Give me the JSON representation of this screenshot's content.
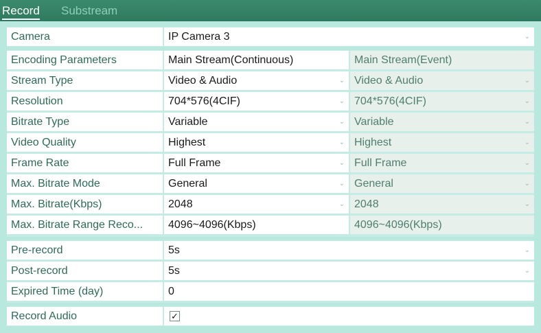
{
  "tabs": {
    "record": "Record",
    "substream": "Substream"
  },
  "camera": {
    "label": "Camera",
    "value": "IP Camera 3"
  },
  "encoding": {
    "label": "Encoding Parameters",
    "col1": "Main Stream(Continuous)",
    "col2": "Main Stream(Event)"
  },
  "params": [
    {
      "label": "Stream Type",
      "v1": "Video & Audio",
      "v2": "Video & Audio"
    },
    {
      "label": "Resolution",
      "v1": "704*576(4CIF)",
      "v2": "704*576(4CIF)"
    },
    {
      "label": "Bitrate Type",
      "v1": "Variable",
      "v2": "Variable"
    },
    {
      "label": "Video Quality",
      "v1": "Highest",
      "v2": "Highest"
    },
    {
      "label": "Frame Rate",
      "v1": "Full Frame",
      "v2": "Full Frame"
    },
    {
      "label": "Max. Bitrate Mode",
      "v1": "General",
      "v2": "General"
    },
    {
      "label": "Max. Bitrate(Kbps)",
      "v1": "2048",
      "v2": "2048"
    },
    {
      "label": "Max. Bitrate Range Reco...",
      "v1": "4096~4096(Kbps)",
      "v2": "4096~4096(Kbps)"
    }
  ],
  "prerecord": {
    "label": "Pre-record",
    "value": "5s"
  },
  "postrecord": {
    "label": "Post-record",
    "value": "5s"
  },
  "expired": {
    "label": "Expired Time (day)",
    "value": "0"
  },
  "record_audio": {
    "label": "Record Audio",
    "checked": true,
    "mark": "✓"
  },
  "icons": {
    "dropdown": "chevron-down-icon",
    "check": "checkmark-icon"
  }
}
